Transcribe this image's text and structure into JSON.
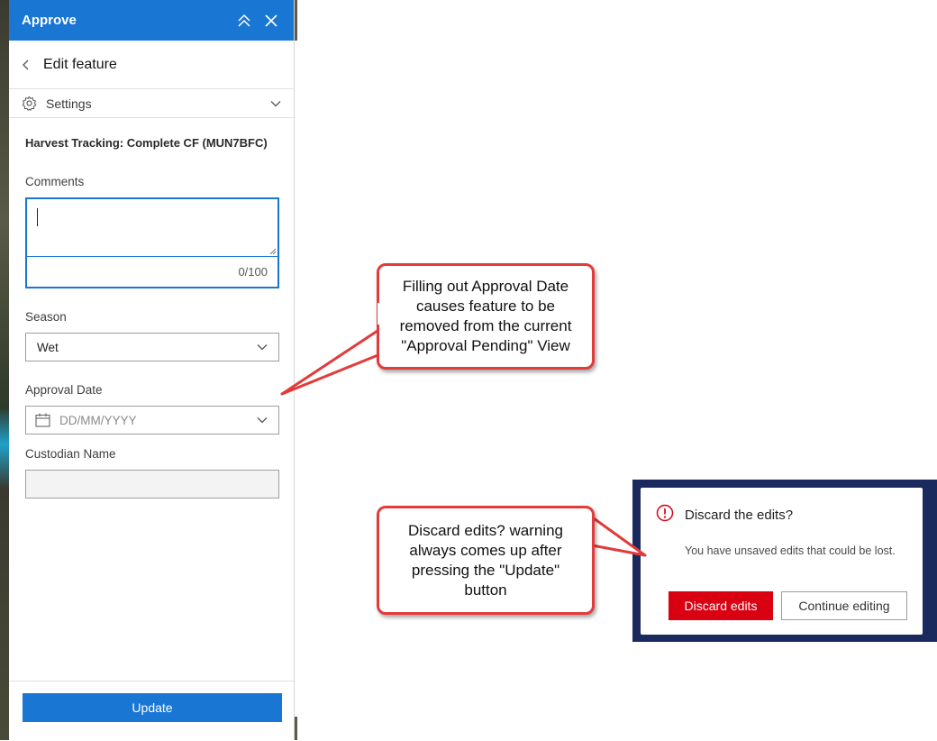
{
  "panel": {
    "title": "Approve",
    "subtitle": "Edit feature",
    "settings_label": "Settings",
    "layer_title": "Harvest Tracking: Complete CF (MUN7BFC)",
    "fields": {
      "comments": {
        "label": "Comments",
        "value": "",
        "counter": "0/100"
      },
      "season": {
        "label": "Season",
        "value": "Wet"
      },
      "approval_date": {
        "label": "Approval Date",
        "placeholder": "DD/MM/YYYY"
      },
      "custodian_name": {
        "label": "Custodian Name",
        "value": ""
      }
    },
    "update_label": "Update"
  },
  "callouts": {
    "approval_date": [
      "Filling out Approval Date",
      "causes feature to be",
      "removed from the current",
      "\"Approval Pending\" View"
    ],
    "discard": [
      "Discard edits? warning",
      "always comes up after",
      "pressing the \"Update\"",
      "button"
    ]
  },
  "dialog": {
    "title": "Discard the edits?",
    "message": "You have unsaved edits that could be lost.",
    "discard_label": "Discard edits",
    "continue_label": "Continue editing"
  },
  "colors": {
    "accent": "#1976d2",
    "danger": "#d90012",
    "callout_border": "#e23b3b",
    "dialog_backdrop": "#1b2a5e"
  }
}
